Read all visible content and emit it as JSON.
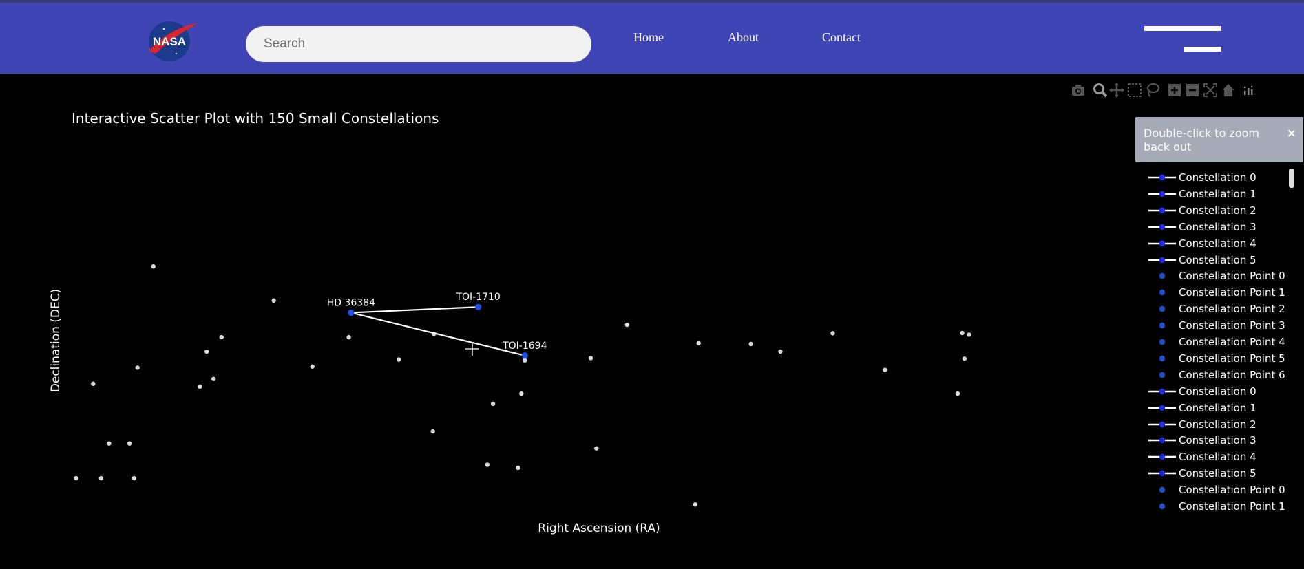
{
  "header": {
    "logo_text": "NASA",
    "search_placeholder": "Search",
    "nav": [
      {
        "label": "Home"
      },
      {
        "label": "About"
      },
      {
        "label": "Contact"
      }
    ],
    "menu_icon": "hamburger-icon"
  },
  "modebar": {
    "icons": [
      "camera-icon",
      "zoom-icon",
      "pan-icon",
      "box-select-icon",
      "lasso-icon",
      "zoom-in-icon",
      "zoom-out-icon",
      "autoscale-icon",
      "reset-axes-icon",
      "plotly-logo-icon"
    ]
  },
  "tooltip": {
    "text": "Double-click to zoom back out",
    "close": "×"
  },
  "legend": [
    {
      "label": "Constellation 0",
      "type": "line"
    },
    {
      "label": "Constellation 1",
      "type": "line"
    },
    {
      "label": "Constellation 2",
      "type": "line"
    },
    {
      "label": "Constellation 3",
      "type": "line"
    },
    {
      "label": "Constellation 4",
      "type": "line"
    },
    {
      "label": "Constellation 5",
      "type": "line"
    },
    {
      "label": "Constellation Point 0",
      "type": "point"
    },
    {
      "label": "Constellation Point 1",
      "type": "point"
    },
    {
      "label": "Constellation Point 2",
      "type": "point"
    },
    {
      "label": "Constellation Point 3",
      "type": "point"
    },
    {
      "label": "Constellation Point 4",
      "type": "point"
    },
    {
      "label": "Constellation Point 5",
      "type": "point"
    },
    {
      "label": "Constellation Point 6",
      "type": "point"
    },
    {
      "label": "Constellation 0",
      "type": "line"
    },
    {
      "label": "Constellation 1",
      "type": "line"
    },
    {
      "label": "Constellation 2",
      "type": "line"
    },
    {
      "label": "Constellation 3",
      "type": "line"
    },
    {
      "label": "Constellation 4",
      "type": "line"
    },
    {
      "label": "Constellation 5",
      "type": "line"
    },
    {
      "label": "Constellation Point 0",
      "type": "point"
    },
    {
      "label": "Constellation Point 1",
      "type": "point"
    }
  ],
  "colors": {
    "navbar": "#3f45b5",
    "star": "#d9d9d9",
    "highlight": "#1f4fe8",
    "line": "#ffffff"
  },
  "chart_data": {
    "type": "scatter",
    "title": "Interactive Scatter Plot with 150 Small Constellations",
    "xlabel": "Right Ascension (RA)",
    "ylabel": "Declination (DEC)",
    "xlim": [
      0,
      100
    ],
    "ylim": [
      0,
      100
    ],
    "grid": false,
    "legend_position": "right",
    "stars": [
      [
        13.5,
        88
      ],
      [
        24.1,
        75.9
      ],
      [
        19.5,
        62.9
      ],
      [
        18.2,
        57.8
      ],
      [
        8.2,
        46.4
      ],
      [
        30.7,
        62.9
      ],
      [
        12.1,
        52.1
      ],
      [
        11.4,
        25.2
      ],
      [
        9.6,
        25.2
      ],
      [
        11.8,
        12.9
      ],
      [
        8.9,
        12.9
      ],
      [
        6.7,
        12.9
      ],
      [
        18.8,
        48.1
      ],
      [
        17.6,
        45.4
      ],
      [
        27.5,
        52.5
      ],
      [
        35.1,
        55
      ],
      [
        38.2,
        64.1
      ],
      [
        38.1,
        29.5
      ],
      [
        43.4,
        39.3
      ],
      [
        46.2,
        54.7
      ],
      [
        52,
        55.5
      ],
      [
        45.9,
        42.9
      ],
      [
        42.9,
        17.7
      ],
      [
        45.6,
        16.6
      ],
      [
        52.5,
        23.5
      ],
      [
        61.2,
        3.6
      ],
      [
        55.2,
        67.3
      ],
      [
        61.5,
        60.8
      ],
      [
        66.1,
        60.5
      ],
      [
        68.7,
        57.8
      ],
      [
        73.3,
        64.3
      ],
      [
        77.9,
        51.3
      ],
      [
        84.3,
        42.9
      ],
      [
        84.7,
        64.4
      ],
      [
        85.3,
        63.8
      ],
      [
        84.9,
        55.3
      ]
    ],
    "constellation": {
      "points": [
        {
          "label": "HD 36384",
          "x": 30.9,
          "y": 71.6
        },
        {
          "label": "TOI-1710",
          "x": 42.1,
          "y": 73.6
        },
        {
          "label": "TOI-1694",
          "x": 46.2,
          "y": 56.4
        }
      ],
      "edges": [
        [
          0,
          1
        ],
        [
          0,
          2
        ]
      ]
    }
  }
}
